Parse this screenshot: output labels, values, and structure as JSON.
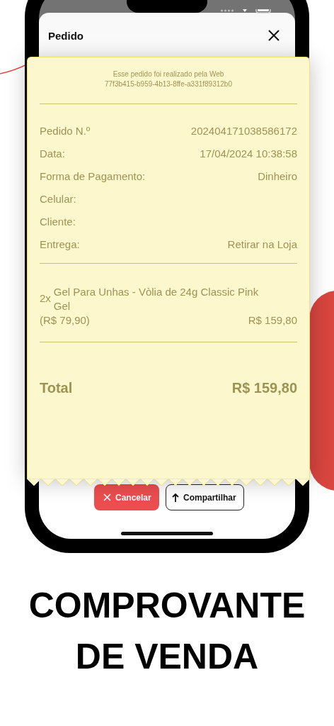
{
  "sheet": {
    "title": "Pedido"
  },
  "receipt": {
    "notice": "Esse pedido foi realizado pela Web",
    "order_id": "77f3b415-b959-4b13-8ffe-a331f89312b0",
    "fields": [
      {
        "label": "Pedido N.º",
        "value": "202404171038586172"
      },
      {
        "label": "Data:",
        "value": "17/04/2024 10:38:58"
      },
      {
        "label": "Forma de Pagamento:",
        "value": "Dinheiro"
      },
      {
        "label": "Celular:"
      },
      {
        "label": "Cliente:"
      },
      {
        "label": "Entrega:",
        "value": "Retirar na Loja"
      }
    ],
    "items": [
      {
        "qty": "2x",
        "name": "Gel Para Unhas - Vòlia de 24g Classic Pink Gel",
        "unit_price": "(R$ 79,90)",
        "total": "R$ 159,80"
      }
    ],
    "total_label": "Total",
    "total_value": "R$ 159,80"
  },
  "buttons": [
    {
      "label": "Cancelar",
      "kind": "danger"
    },
    {
      "label": "Compartilhar",
      "kind": "outline"
    }
  ],
  "headline": [
    "COMPROVANTE",
    "DE VENDA"
  ]
}
